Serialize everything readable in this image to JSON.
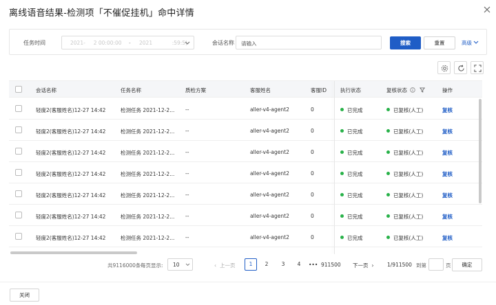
{
  "dialog": {
    "title": "离线语音结果-检测项「不催促挂机」命中详情"
  },
  "filters": {
    "task_time_label": "任务时间",
    "date_start": "2021-     2 00:00:00",
    "date_sep": "-",
    "date_end": "2021            :59:5)",
    "session_name_label": "会话名称",
    "session_name_placeholder": "请输入",
    "search_label": "搜索",
    "reset_label": "重置",
    "advanced_label": "高级"
  },
  "table": {
    "columns": [
      "会话名称",
      "任务名称",
      "质检方案",
      "客服姓名",
      "客服ID",
      "执行状态",
      "复核状态",
      "操作"
    ],
    "rows": [
      {
        "session": "轻度2(客服姓名)12-27 14:42",
        "task": "检测任务 2021-12-2...",
        "scheme": "--",
        "agent": "aller-v4-agent2",
        "agent_id": "0",
        "exec_status": "已完成",
        "review_status": "已复核(人工)",
        "action": "复核"
      },
      {
        "session": "轻度2(客服姓名)12-27 14:42",
        "task": "检测任务 2021-12-2...",
        "scheme": "--",
        "agent": "aller-v4-agent2",
        "agent_id": "0",
        "exec_status": "已完成",
        "review_status": "已复核(人工)",
        "action": "复核"
      },
      {
        "session": "轻度2(客服姓名)12-27 14:42",
        "task": "检测任务 2021-12-2...",
        "scheme": "--",
        "agent": "aller-v4-agent2",
        "agent_id": "0",
        "exec_status": "已完成",
        "review_status": "已复核(人工)",
        "action": "复核"
      },
      {
        "session": "轻度2(客服姓名)12-27 14:42",
        "task": "检测任务 2021-12-2...",
        "scheme": "--",
        "agent": "aller-v4-agent2",
        "agent_id": "0",
        "exec_status": "已完成",
        "review_status": "已复核(人工)",
        "action": "复核"
      },
      {
        "session": "轻度2(客服姓名)12-27 14:42",
        "task": "检测任务 2021-12-2...",
        "scheme": "--",
        "agent": "aller-v4-agent2",
        "agent_id": "0",
        "exec_status": "已完成",
        "review_status": "已复核(人工)",
        "action": "复核"
      },
      {
        "session": "轻度2(客服姓名)12-27 14:42",
        "task": "检测任务 2021-12-2...",
        "scheme": "--",
        "agent": "aller-v4-agent2",
        "agent_id": "0",
        "exec_status": "已完成",
        "review_status": "已复核(人工)",
        "action": "复核"
      },
      {
        "session": "轻度2(客服姓名)12-27 14:42",
        "task": "检测任务 2021-12-2...",
        "scheme": "--",
        "agent": "aller-v4-agent2",
        "agent_id": "0",
        "exec_status": "已完成",
        "review_status": "已复核(人工)",
        "action": "复核"
      }
    ]
  },
  "pagination": {
    "total_text": "共9116000条",
    "per_page_label": "每页显示:",
    "page_size": "10",
    "prev_label": "上一页",
    "pages": [
      "1",
      "2",
      "3",
      "4"
    ],
    "ellipsis": "•••",
    "last_page": "911500",
    "next_label": "下一页",
    "page_of": "1/911500",
    "goto_label": "到第",
    "page_unit": "页",
    "confirm_label": "确定"
  },
  "footer": {
    "close_label": "关闭"
  },
  "colors": {
    "primary": "#1f5dc6",
    "status_ok": "#27b148"
  }
}
